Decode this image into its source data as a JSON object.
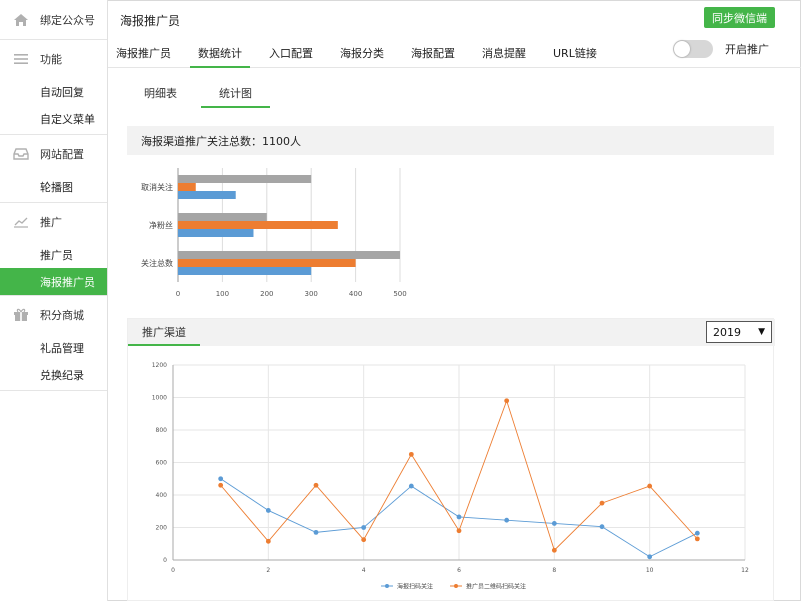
{
  "sidebar": {
    "top": {
      "label": "绑定公众号",
      "icon": "home-icon"
    },
    "groups": [
      {
        "label": "功能",
        "icon": "menu-icon",
        "items": [
          "自动回复",
          "自定义菜单"
        ]
      },
      {
        "label": "网站配置",
        "icon": "inbox-icon",
        "items": [
          "轮播图"
        ]
      },
      {
        "label": "推广",
        "icon": "chart-line-icon",
        "items": [
          "推广员",
          "海报推广员"
        ]
      },
      {
        "label": "积分商城",
        "icon": "gift-icon",
        "items": [
          "礼品管理",
          "兑换纪录"
        ]
      }
    ],
    "active_item": "海报推广员"
  },
  "header": {
    "title": "海报推广员",
    "sync_label": "同步微信端",
    "tabs": [
      "海报推广员",
      "数据统计",
      "入口配置",
      "海报分类",
      "海报配置",
      "消息提醒",
      "URL链接"
    ],
    "active_tab": "数据统计",
    "toggle_label": "开启推广",
    "toggle_on": false
  },
  "subtabs": [
    "明细表",
    "统计图"
  ],
  "active_subtab": "统计图",
  "summary": {
    "text": "海报渠道推广关注总数：1100人"
  },
  "channel": {
    "title": "推广渠道",
    "year": "2019"
  },
  "colors": {
    "accent": "#44b549",
    "blue": "#5b9bd5",
    "orange": "#ed7d31",
    "gray": "#a5a5a5"
  },
  "chart_data": [
    {
      "type": "bar",
      "orientation": "horizontal",
      "categories": [
        "关注总数",
        "净粉丝",
        "取消关注"
      ],
      "series": [
        {
          "values": [
            300,
            170,
            130
          ]
        },
        {
          "values": [
            400,
            360,
            40
          ]
        },
        {
          "values": [
            500,
            200,
            300
          ]
        }
      ],
      "xlim": [
        0,
        500
      ],
      "xticks": [
        0,
        100,
        200,
        300,
        400,
        500
      ],
      "grid": true
    },
    {
      "type": "line",
      "x": [
        1,
        2,
        3,
        4,
        5,
        6,
        7,
        8,
        9,
        10,
        11
      ],
      "series": [
        {
          "name": "海报扫码关注",
          "values": [
            500,
            305,
            170,
            200,
            455,
            265,
            245,
            225,
            205,
            20,
            165
          ]
        },
        {
          "name": "推广员二维码扫码关注",
          "values": [
            460,
            115,
            460,
            125,
            650,
            180,
            980,
            60,
            350,
            455,
            130
          ]
        }
      ],
      "xlim": [
        0,
        12
      ],
      "ylim": [
        0,
        1200
      ],
      "xticks": [
        0,
        2,
        4,
        6,
        8,
        10,
        12
      ],
      "yticks": [
        0,
        200,
        400,
        600,
        800,
        1000,
        1200
      ],
      "grid": true,
      "legend": "bottom"
    }
  ]
}
